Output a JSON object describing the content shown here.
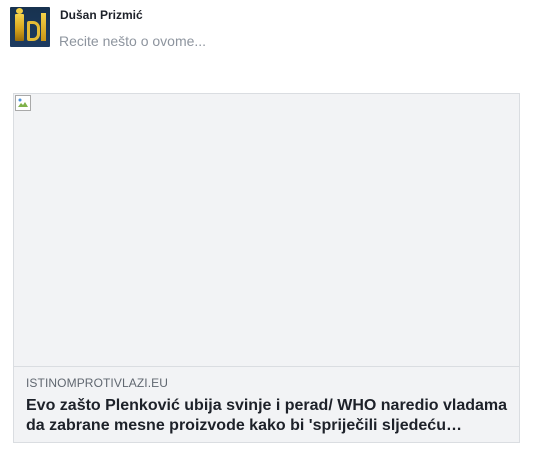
{
  "composer": {
    "user_name": "Dušan Prizmić",
    "placeholder": "Recite nešto o ovome..."
  },
  "link_preview": {
    "domain": "ISTINOMPROTIVLAZI.EU",
    "title": "Evo zašto Plenković ubija svinje i perad/ WHO naredio vladama da zabrane mesne proizvode kako bi 'spriječili sljedeću…"
  },
  "icons": {
    "avatar": "user-avatar-logo",
    "image_placeholder": "broken-image-icon"
  },
  "colors": {
    "name_text": "#1d2129",
    "placeholder_text": "#8d949e",
    "domain_text": "#606770",
    "card_background": "#f2f3f5",
    "card_border": "#dadde1"
  }
}
